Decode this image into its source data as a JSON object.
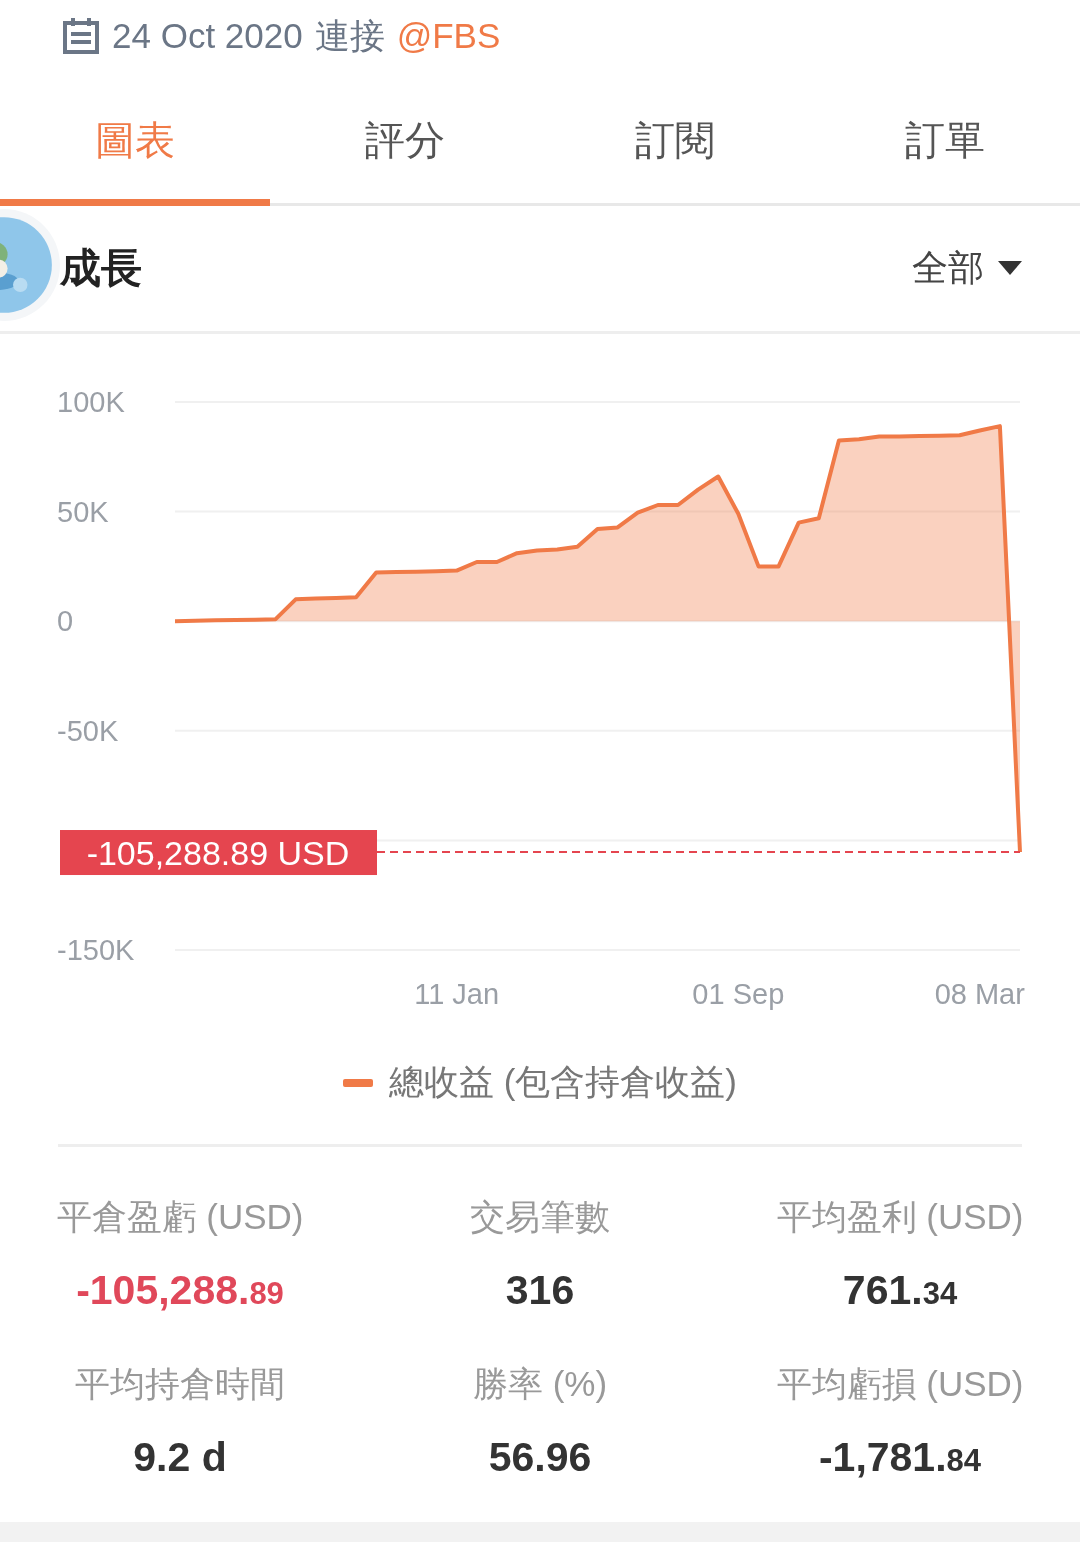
{
  "header": {
    "date": "24 Oct 2020",
    "connect_label": "連接",
    "broker": "@FBS"
  },
  "tabs": [
    {
      "label": "圖表",
      "selected": true
    },
    {
      "label": "評分",
      "selected": false
    },
    {
      "label": "訂閱",
      "selected": false
    },
    {
      "label": "訂單",
      "selected": false
    }
  ],
  "section": {
    "title": "成長",
    "filter": "全部"
  },
  "chart_data": {
    "type": "area",
    "grid": true,
    "ylim": [
      -150000,
      100000
    ],
    "yticks": [
      {
        "value": 100000,
        "label": "100K"
      },
      {
        "value": 50000,
        "label": "50K"
      },
      {
        "value": 0,
        "label": "0"
      },
      {
        "value": -50000,
        "label": "-50K"
      },
      {
        "value": -150000,
        "label": "-150K"
      }
    ],
    "categories": [
      null,
      null,
      null,
      null,
      null,
      null,
      null,
      null,
      null,
      null,
      null,
      null,
      null,
      null,
      "11 Jan",
      null,
      null,
      null,
      null,
      null,
      null,
      null,
      null,
      null,
      null,
      null,
      null,
      null,
      "01 Sep",
      null,
      null,
      null,
      null,
      null,
      null,
      null,
      null,
      null,
      null,
      null,
      "08 Mar",
      null,
      null
    ],
    "series": [
      {
        "name": "總收益 (包含持倉收益)",
        "color": "#f07a47",
        "values": [
          0,
          200,
          400,
          500,
          700,
          900,
          10000,
          10300,
          10600,
          10900,
          22200,
          22400,
          22600,
          22800,
          23100,
          27000,
          27000,
          31000,
          32300,
          32700,
          34000,
          42000,
          42800,
          49500,
          53000,
          53000,
          60000,
          66000,
          49000,
          25000,
          25000,
          45000,
          47000,
          82400,
          83000,
          84200,
          84300,
          84500,
          84600,
          84800,
          87000,
          89000,
          -105300
        ]
      }
    ],
    "annotations": [
      "-105,288.89 USD"
    ]
  },
  "stats": [
    {
      "label": "平倉盈虧 (USD)",
      "value": "-105,288.89",
      "color": "#e0485a",
      "small_decimals": true
    },
    {
      "label": "交易筆數",
      "value": "316",
      "color": "#333333"
    },
    {
      "label": "平均盈利 (USD)",
      "value": "761.34",
      "color": "#333333",
      "small_decimals": true
    },
    {
      "label": "平均持倉時間",
      "value": "9.2 d",
      "color": "#333333",
      "small_decimals": false
    },
    {
      "label": "勝率 (%)",
      "value": "56.96",
      "color": "#333333",
      "small_decimals": false
    },
    {
      "label": "平均虧損 (USD)",
      "value": "-1,781.84",
      "color": "#333333",
      "small_decimals": true
    }
  ]
}
